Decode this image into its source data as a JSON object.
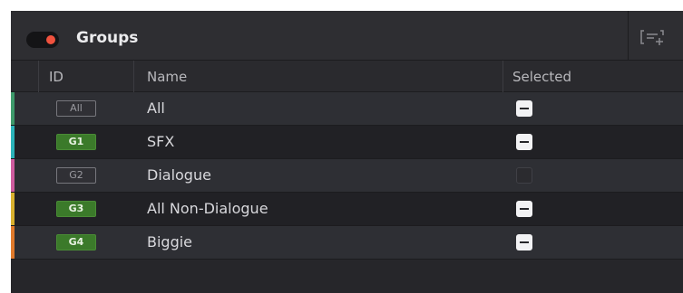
{
  "header": {
    "title": "Groups",
    "toggle_on": true,
    "add_icon": "add-group-icon"
  },
  "columns": [
    "ID",
    "Name",
    "Selected"
  ],
  "rows": [
    {
      "id": "All",
      "name": "All",
      "selected": "on",
      "badge_style": "outline",
      "color": "#3e9a6b"
    },
    {
      "id": "G1",
      "name": "SFX",
      "selected": "on",
      "badge_style": "filled",
      "color": "#2bb3b9"
    },
    {
      "id": "G2",
      "name": "Dialogue",
      "selected": "off",
      "badge_style": "outline",
      "color": "#cf5c9f"
    },
    {
      "id": "G3",
      "name": "All Non-Dialogue",
      "selected": "on",
      "badge_style": "filled",
      "color": "#d9b12f"
    },
    {
      "id": "G4",
      "name": "Biggie",
      "selected": "on",
      "badge_style": "filled",
      "color": "#e07a2b"
    }
  ],
  "colors": {
    "toggle_dot": "#f0523e",
    "badge_green": "#3b7a2a"
  }
}
